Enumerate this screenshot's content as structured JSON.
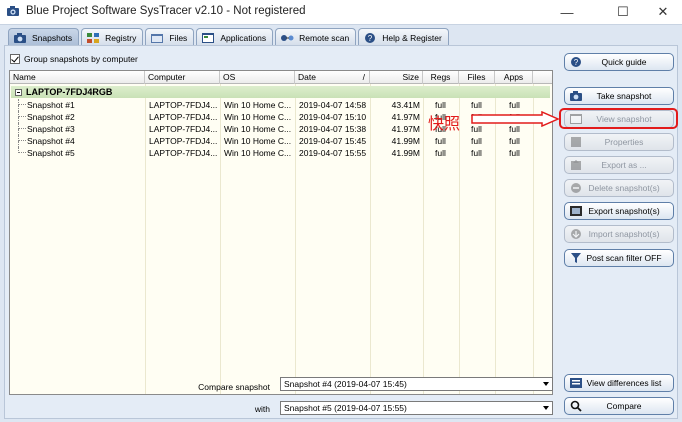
{
  "window": {
    "title": "Blue Project Software SysTracer v2.10 - Not registered",
    "minimize_glyph": "—",
    "maximize_glyph": "☐",
    "close_glyph": "✕"
  },
  "tabs": [
    {
      "label": "Snapshots",
      "icon": "camera-icon",
      "active": true
    },
    {
      "label": "Registry",
      "icon": "registry-icon",
      "active": false
    },
    {
      "label": "Files",
      "icon": "files-icon",
      "active": false
    },
    {
      "label": "Applications",
      "icon": "applications-icon",
      "active": false
    },
    {
      "label": "Remote scan",
      "icon": "remote-scan-icon",
      "active": false
    },
    {
      "label": "Help & Register",
      "icon": "help-icon",
      "active": false
    }
  ],
  "group_by_computer": {
    "label": "Group snapshots by computer",
    "checked": true
  },
  "list": {
    "columns": [
      {
        "label": "Name"
      },
      {
        "label": "Computer"
      },
      {
        "label": "OS"
      },
      {
        "label": "Date"
      },
      {
        "label": "/"
      },
      {
        "label": "Size"
      },
      {
        "label": "Regs"
      },
      {
        "label": "Files"
      },
      {
        "label": "Apps"
      }
    ],
    "group": "LAPTOP-7FDJ4RGB",
    "rows": [
      {
        "name": "Snapshot #1",
        "computer": "LAPTOP-7FDJ4...",
        "os": "Win 10 Home C...",
        "date": "2019-04-07 14:58",
        "size": "43.41M",
        "regs": "full",
        "files": "full",
        "apps": "full"
      },
      {
        "name": "Snapshot #2",
        "computer": "LAPTOP-7FDJ4...",
        "os": "Win 10 Home C...",
        "date": "2019-04-07 15:10",
        "size": "41.97M",
        "regs": "full",
        "files": "full",
        "apps": "full"
      },
      {
        "name": "Snapshot #3",
        "computer": "LAPTOP-7FDJ4...",
        "os": "Win 10 Home C...",
        "date": "2019-04-07 15:38",
        "size": "41.97M",
        "regs": "full",
        "files": "full",
        "apps": "full"
      },
      {
        "name": "Snapshot #4",
        "computer": "LAPTOP-7FDJ4...",
        "os": "Win 10 Home C...",
        "date": "2019-04-07 15:45",
        "size": "41.99M",
        "regs": "full",
        "files": "full",
        "apps": "full"
      },
      {
        "name": "Snapshot #5",
        "computer": "LAPTOP-7FDJ4...",
        "os": "Win 10 Home C...",
        "date": "2019-04-07 15:55",
        "size": "41.99M",
        "regs": "full",
        "files": "full",
        "apps": "full"
      }
    ]
  },
  "buttons": {
    "quick_guide": "Quick guide",
    "take_snapshot": "Take snapshot",
    "view_snapshot": "View snapshot",
    "properties": "Properties",
    "export_as": "Export as ...",
    "delete_snapshots": "Delete snapshot(s)",
    "export_snapshots": "Export snapshot(s)",
    "import_snapshots": "Import snapshot(s)",
    "post_scan_filter": "Post scan filter OFF",
    "view_differences": "View differences list",
    "compare": "Compare"
  },
  "annotation": {
    "text": "快照",
    "color": "#e21b1b"
  },
  "compare": {
    "label": "Compare snapshot",
    "value": "Snapshot #4 (2019-04-07 15:45)",
    "with_label": "with",
    "with_value": "Snapshot #5 (2019-04-07 15:55)"
  },
  "colors": {
    "accent": "#5f7fa8",
    "list_background": "#fffef3",
    "group_row": "#c9e1b6",
    "annotation_red": "#e21b1b"
  }
}
